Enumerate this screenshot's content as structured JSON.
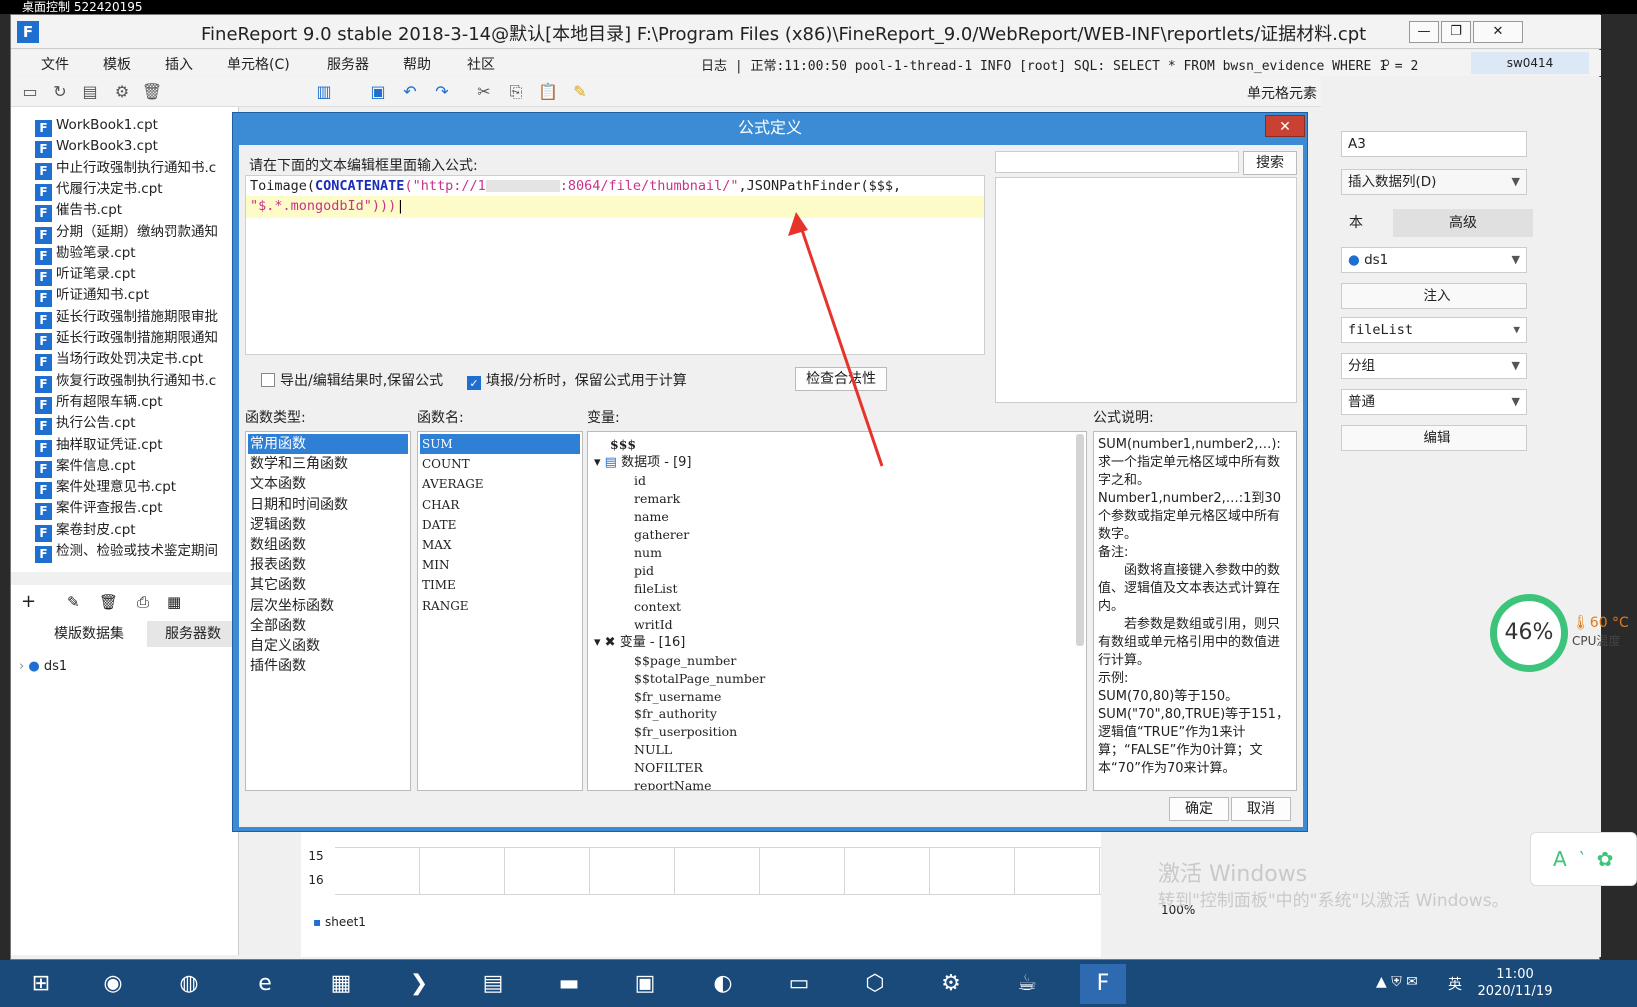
{
  "remote": {
    "title": "桌面控制 522420195"
  },
  "app": {
    "title": "FineReport 9.0 stable 2018-3-14@默认[本地目录]    F:\\Program Files (x86)\\FineReport_9.0/WebReport/WEB-INF\\reportlets/证据材料.cpt",
    "menus": [
      "文件",
      "模板",
      "插入",
      "单元格(C)",
      "服务器",
      "帮助",
      "社区"
    ],
    "log": "日志  |  正常:11:00:50 pool-1-thread-1 INFO [root] SQL: SELECT * FROM bwsn_evidence WHERE 1 = 2",
    "user": "sw0414",
    "minimize": "—",
    "restore": "❐",
    "close": "✕",
    "cell_elements_label": "单元格元素"
  },
  "tree": {
    "items": [
      "WorkBook1.cpt",
      "WorkBook3.cpt",
      "中止行政强制执行通知书.c",
      "代履行决定书.cpt",
      "催告书.cpt",
      "分期（延期）缴纳罚款通知",
      "勘验笔录.cpt",
      "听证笔录.cpt",
      "听证通知书.cpt",
      "延长行政强制措施期限审批",
      "延长行政强制措施期限通知",
      "当场行政处罚决定书.cpt",
      "恢复行政强制执行通知书.c",
      "所有超限车辆.cpt",
      "执行公告.cpt",
      "抽样取证凭证.cpt",
      "案件信息.cpt",
      "案件处理意见书.cpt",
      "案件评查报告.cpt",
      "案卷封皮.cpt",
      "检测、检验或技术鉴定期间"
    ]
  },
  "datasets": {
    "tab1": "模版数据集",
    "tab2": "服务器数",
    "items": [
      "ds1"
    ]
  },
  "right_panel": {
    "cell": "A3",
    "insert_col": "插入数据列(D)",
    "tab_basic": "本",
    "tab_advanced": "高级",
    "dataset": "ds1",
    "inject": "注入",
    "field": "fileList",
    "group": "分组",
    "mode": "普通",
    "edit": "编辑"
  },
  "dialog": {
    "title": "公式定义",
    "close": "✕",
    "prompt": "请在下面的文本编辑框里面输入公式:",
    "formula_line1_fn": "Toimage(",
    "formula_line1_concat": "CONCATENATE",
    "formula_line1_str1": "(\"http://1",
    "formula_line1_str2": ":8064/file/thumbnail/\"",
    "formula_line1_rest": ",JSONPathFinder($$$,",
    "formula_line2": "\"$.*.mongodbId\")))",
    "search_btn": "搜索",
    "opt_export": "导出/编辑结果时,保留公式",
    "opt_fill": "填报/分析时，保留公式用于计算",
    "check_btn": "检查合法性",
    "fn_type_label": "函数类型:",
    "fn_name_label": "函数名:",
    "var_label": "变量:",
    "desc_label": "公式说明:",
    "fn_types": [
      "常用函数",
      "数学和三角函数",
      "文本函数",
      "日期和时间函数",
      "逻辑函数",
      "数组函数",
      "报表函数",
      "其它函数",
      "层次坐标函数",
      "全部函数",
      "自定义函数",
      "插件函数"
    ],
    "fn_names": [
      "SUM",
      "COUNT",
      "AVERAGE",
      "CHAR",
      "DATE",
      "MAX",
      "MIN",
      "TIME",
      "RANGE"
    ],
    "var_root": "$$$",
    "var_data_group": "数据项 - [9]",
    "var_data_items": [
      "id",
      "remark",
      "name",
      "gatherer",
      "num",
      "pid",
      "fileList",
      "context",
      "writId"
    ],
    "var_var_group": "变量 - [16]",
    "var_var_items": [
      "$$page_number",
      "$$totalPage_number",
      "$fr_username",
      "$fr_authority",
      "$fr_userposition",
      "NULL",
      "NOFILTER",
      "reportName"
    ],
    "desc": [
      "SUM(number1,number2,…): 求一个指定单元格区域中所有数字之和。",
      "Number1,number2,…:1到30个参数或指定单元格区域中所有数字。",
      "备注:",
      "　　函数将直接键入参数中的数值、逻辑值及文本表达式计算在内。",
      "　　若参数是数组或引用，则只有数组或单元格引用中的数值进行计算。",
      "示例:",
      "SUM(70,80)等于150。",
      "SUM(\"70\",80,TRUE)等于151，逻辑值“TRUE”作为1来计算；“FALSE”作为0计算；文本“70”作为70来计算。"
    ],
    "ok": "确定",
    "cancel": "取消"
  },
  "sheet": {
    "rows": [
      "15",
      "16"
    ],
    "tab": "sheet1",
    "zoom": "100%"
  },
  "overlay": {
    "cpu_percent": "46%",
    "cpu_temp": "60 °C",
    "cpu_temp_label": "CPU温度",
    "watermark1": "激活 Windows",
    "watermark2": "转到\"控制面板\"中的\"系统\"以激活 Windows。"
  },
  "taskbar": {
    "time": "11:00",
    "date": "2020/11/19",
    "ime": "英"
  },
  "colors": {
    "dialog_blue": "#3b8bd5",
    "selection": "#2f7fd5",
    "arrow": "#e8332a",
    "cpu_ring": "#3cc47a"
  }
}
